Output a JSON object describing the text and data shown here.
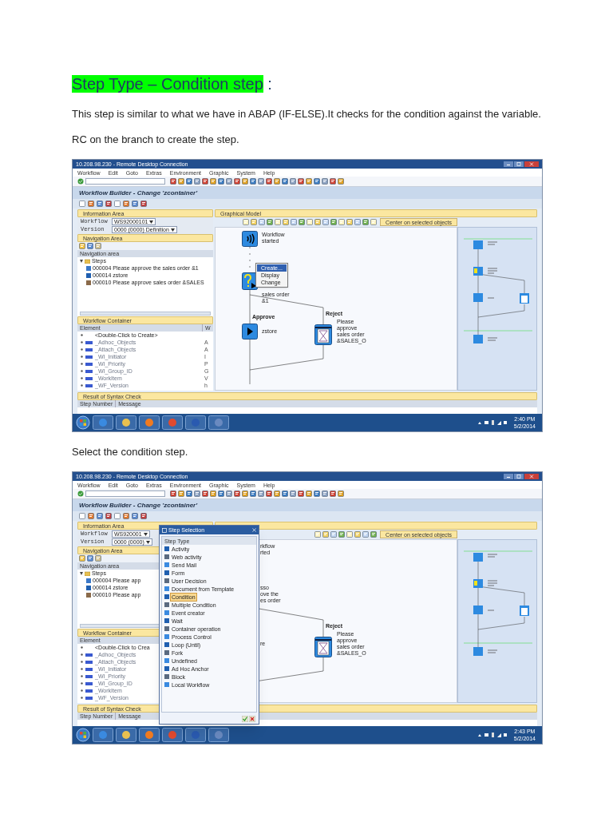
{
  "heading": {
    "text": "Step Type – Condition step",
    "suffix": " :"
  },
  "blocks": [
    {
      "kind": "paragraph",
      "text": "This step is similar to what we have in ABAP (IF-ELSE).It checks for the condition against the variable."
    },
    {
      "kind": "paragraph",
      "text": "RC on the branch to create the step."
    },
    {
      "kind": "screenshot",
      "title": "10.208.98.230 - Remote Desktop Connection",
      "menu": [
        "Workflow",
        "Edit",
        "Goto",
        "Extras",
        "Environment",
        "Graphic",
        "System",
        "Help"
      ],
      "header": "Workflow Builder - Change 'zcontainer'",
      "info": {
        "title": "Information Area",
        "fields": [
          {
            "label": "Workflow",
            "value": "WS92000101"
          },
          {
            "label": "Version",
            "value": "0000 (0000) Definition"
          }
        ]
      },
      "nav": {
        "title": "Navigation Area",
        "column": "Navigation area",
        "root": "Steps",
        "items": [
          {
            "label": "000004 Please approve the sales order &1",
            "kind": "condition"
          },
          {
            "label": "000014 zstore",
            "kind": "activity"
          },
          {
            "label": "000010 Please approve sales order &SALES",
            "kind": "decision"
          }
        ]
      },
      "container": {
        "title": "Workflow Container",
        "columns": [
          "Element",
          "W"
        ],
        "rows": [
          {
            "kind": "hint",
            "element": "<Double-Click to Create>"
          },
          {
            "kind": "element",
            "element": "_Adhoc_Objects",
            "w": "A"
          },
          {
            "kind": "element",
            "element": "_Attach_Objects",
            "w": "A"
          },
          {
            "kind": "element",
            "element": "_WI_Initiator",
            "w": "I"
          },
          {
            "kind": "element",
            "element": "_WI_Priority",
            "w": "P"
          },
          {
            "kind": "element",
            "element": "_WI_Group_ID",
            "w": "G"
          },
          {
            "kind": "element",
            "element": "_WorkItem",
            "w": "V"
          },
          {
            "kind": "element",
            "element": "_WF_Version",
            "w": "h"
          }
        ]
      },
      "graph": {
        "title": "Graphical Model",
        "center_button": "Center on selected objects",
        "branches": [
          {
            "kind": "approve",
            "label": "Approve"
          },
          {
            "kind": "reject",
            "label": "Reject"
          }
        ],
        "nodes": [
          {
            "kind": "start",
            "lines": [
              "Workflow",
              "started"
            ]
          },
          {
            "kind": "condition",
            "lines": [
              "sales order",
              "&1"
            ]
          },
          {
            "kind": "activity",
            "lines": [
              "zstore"
            ]
          },
          {
            "kind": "decision",
            "lines": [
              "Please",
              "approve",
              "sales order",
              "&SALES_O"
            ]
          }
        ],
        "context_menu": {
          "items": [
            {
              "label": "Create...",
              "selected": true
            },
            {
              "label": "Display",
              "selected": false
            },
            {
              "label": "Change",
              "selected": false
            }
          ]
        }
      },
      "syntax": {
        "title": "Result of Syntax Check",
        "columns": [
          "Step Number",
          "Message"
        ]
      },
      "clock": {
        "time": "2:40 PM",
        "date": "5/2/2014"
      }
    },
    {
      "kind": "paragraph",
      "text": "Select the condition step."
    },
    {
      "kind": "screenshot",
      "title": "10.208.98.230 - Remote Desktop Connection",
      "menu": [
        "Workflow",
        "Edit",
        "Goto",
        "Extras",
        "Environment",
        "Graphic",
        "System",
        "Help"
      ],
      "header": "Workflow Builder - Change 'zcontainer'",
      "info": {
        "title": "Information Area",
        "fields": [
          {
            "label": "Workflow",
            "value": "WS920001"
          },
          {
            "label": "Version",
            "value": "0000 (0000)"
          }
        ]
      },
      "nav": {
        "title": "Navigation Area",
        "column": "Navigation area",
        "root": "Steps",
        "items": [
          {
            "label": "000004 Please app",
            "kind": "condition"
          },
          {
            "label": "000014 zstore",
            "kind": "activity"
          },
          {
            "label": "000010 Please app",
            "kind": "decision"
          }
        ]
      },
      "container": {
        "title": "Workflow Container",
        "columns": [
          "Element"
        ],
        "rows": [
          {
            "kind": "hint",
            "element": "<Double-Click to Crea"
          },
          {
            "kind": "element",
            "element": "_Adhoc_Objects"
          },
          {
            "kind": "element",
            "element": "_Attach_Objects"
          },
          {
            "kind": "element",
            "element": "_WI_Initiator"
          },
          {
            "kind": "element",
            "element": "_WI_Priority"
          },
          {
            "kind": "element",
            "element": "_WI_Group_ID"
          },
          {
            "kind": "element",
            "element": "_WorkItem"
          },
          {
            "kind": "element",
            "element": "_WF_Version"
          }
        ]
      },
      "graph": {
        "center_button": "Center on selected objects",
        "branches": [
          {
            "kind": "reject",
            "label": "Reject"
          }
        ],
        "nodes": [
          {
            "kind": "covered",
            "lines": [
              "rkflow",
              "rted"
            ]
          },
          {
            "kind": "covered",
            "lines": [
              "sso",
              "ove the",
              "es order"
            ]
          },
          {
            "kind": "covered",
            "lines": [
              "re"
            ]
          },
          {
            "kind": "decision",
            "lines": [
              "Please",
              "approve",
              "sales order",
              "&SALES_O"
            ]
          }
        ]
      },
      "dialog": {
        "title": "Step Selection",
        "column": "Step Type",
        "items": [
          {
            "label": "Activity",
            "selected": false
          },
          {
            "label": "Web activity",
            "selected": false
          },
          {
            "label": "Send Mail",
            "selected": false
          },
          {
            "label": "Form",
            "selected": false
          },
          {
            "label": "User Decision",
            "selected": false
          },
          {
            "label": "Document from Template",
            "selected": false
          },
          {
            "label": "Condition",
            "selected": true
          },
          {
            "label": "Multiple Condition",
            "selected": false
          },
          {
            "label": "Event creator",
            "selected": false
          },
          {
            "label": "Wait",
            "selected": false
          },
          {
            "label": "Container operation",
            "selected": false
          },
          {
            "label": "Process Control",
            "selected": false
          },
          {
            "label": "Loop (Until)",
            "selected": false
          },
          {
            "label": "Fork",
            "selected": false
          },
          {
            "label": "Undefined",
            "selected": false
          },
          {
            "label": "Ad Hoc Anchor",
            "selected": false
          },
          {
            "label": "Block",
            "selected": false
          },
          {
            "label": "Local Workflow",
            "selected": false
          }
        ]
      },
      "syntax": {
        "title": "Result of Syntax Check",
        "columns": [
          "Step Number",
          "Message"
        ]
      },
      "clock": {
        "time": "2:43 PM",
        "date": "5/2/2014"
      }
    }
  ]
}
